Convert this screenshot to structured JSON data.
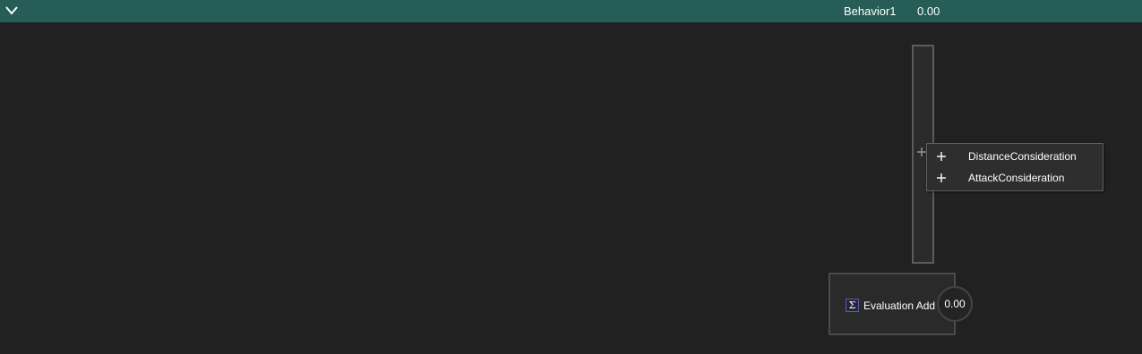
{
  "header": {
    "collapse_icon": "chevron-down-icon",
    "title": "Behavior1",
    "value": "0.00",
    "background_color": "#265d57"
  },
  "slot": {
    "add_icon": "plus-icon"
  },
  "context_menu": {
    "items": [
      {
        "icon": "plus-icon",
        "label": "DistanceConsideration"
      },
      {
        "icon": "plus-icon",
        "label": "AttackConsideration"
      }
    ]
  },
  "evaluation_node": {
    "icon": "sigma-icon",
    "icon_glyph": "Σ",
    "label": "Evaluation Add",
    "output_value": "0.00"
  }
}
